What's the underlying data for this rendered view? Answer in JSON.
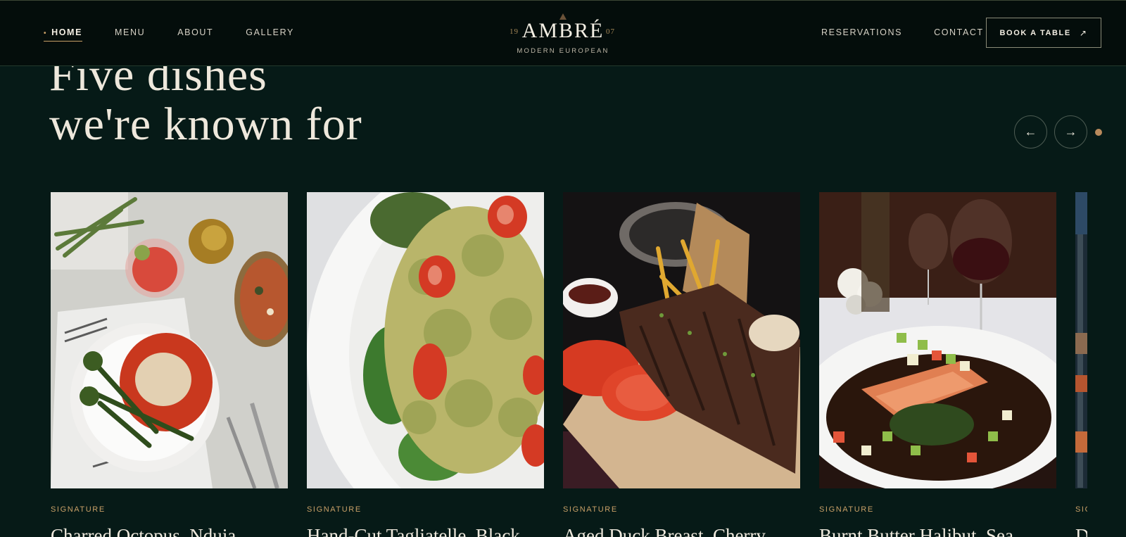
{
  "nav": {
    "left": [
      {
        "label": "HOME",
        "active": true
      },
      {
        "label": "MENU",
        "active": false
      },
      {
        "label": "ABOUT",
        "active": false
      },
      {
        "label": "GALLERY",
        "active": false
      }
    ],
    "right": [
      {
        "label": "RESERVATIONS"
      },
      {
        "label": "CONTACT"
      }
    ],
    "cta": "BOOK A TABLE"
  },
  "brand": {
    "name": "AMBRÉ",
    "year_left": "19",
    "year_right": "07",
    "tagline": "MODERN EUROPEAN"
  },
  "section": {
    "heading_line1": "Five dishes",
    "heading_line2": "we're known for"
  },
  "carousel": {
    "cards": [
      {
        "tag": "SIGNATURE",
        "title": "Charred Octopus, Nduja",
        "image": "octopus-table-photo"
      },
      {
        "tag": "SIGNATURE",
        "title": "Hand-Cut Tagliatelle, Black",
        "image": "pesto-pasta-photo"
      },
      {
        "tag": "SIGNATURE",
        "title": "Aged Duck Breast, Cherry",
        "image": "ribs-board-photo"
      },
      {
        "tag": "SIGNATURE",
        "title": "Burnt Butter Halibut, Sea",
        "image": "salmon-plate-photo"
      },
      {
        "tag": "SIG",
        "title": "D",
        "image": "restaurant-interior-photo"
      }
    ]
  },
  "colors": {
    "background": "#061a17",
    "nav_background": "#040d0b",
    "accent": "#c9a067",
    "text": "#efe9dd"
  }
}
